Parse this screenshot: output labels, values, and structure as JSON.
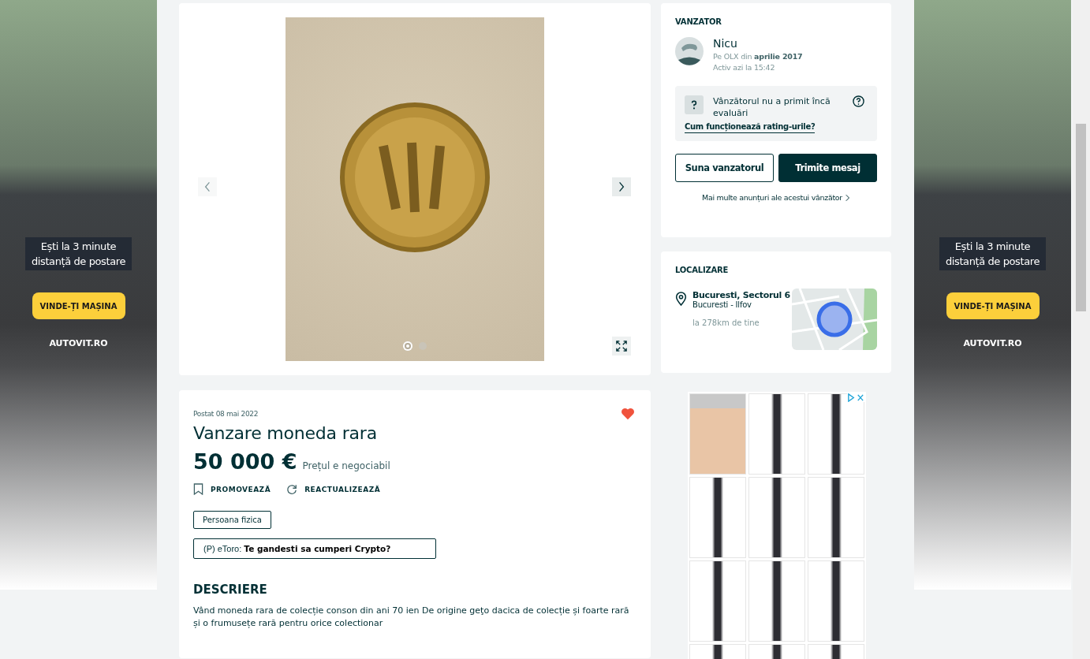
{
  "ads": [
    {
      "line1": "Ești la 3 minute",
      "line2": "distanță de postare",
      "button": "VINDE-ȚI MAȘINA",
      "brand": "AUTOVIT.RO"
    },
    {
      "line1": "Ești la 3 minute",
      "line2": "distanță de postare",
      "button": "VINDE-ȚI MAȘINA",
      "brand": "AUTOVIT.RO"
    }
  ],
  "gallery": {
    "dots": [
      {
        "selected": true
      },
      {
        "selected": false
      }
    ]
  },
  "listing": {
    "posted": "Postat 08 mai 2022",
    "favorite": true,
    "title": "Vanzare moneda rara",
    "price": "50 000 €",
    "price_note": "Prețul e negociabil",
    "actions": [
      {
        "kind": "promote",
        "label": "PROMOVEAZĂ"
      },
      {
        "kind": "refresh",
        "label": "REACTUALIZEAZĂ"
      }
    ],
    "seller_type": "Persoana fizica",
    "promo": "(P) eToro: **Te gandesti sa cumperi Crypto?**",
    "description_heading": "DESCRIERE",
    "description": "Vând moneda rara de colecție conson din ani 70 ien De origine geţo dacica de colecție și foarte rară și o frumusețe rară pentru orice colectionar"
  },
  "seller": {
    "heading": "VANZATOR",
    "name": "Nicu",
    "since": "Pe OLX din **aprilie 2017**",
    "active": "Activ azi la 15:42",
    "rating_text": "Vânzătorul nu a primit încă evaluări",
    "rating_link": "Cum funcționează rating-urile?",
    "call_button": "Suna vanzatorul",
    "message_button": "Trimite mesaj",
    "more_link": "Mai multe anunțuri ale acestui vânzător"
  },
  "location": {
    "heading": "LOCALIZARE",
    "city": "Bucuresti, Sectorul 6",
    "region": "Bucuresti - Ilfov",
    "distance": "la 278km de tine"
  }
}
